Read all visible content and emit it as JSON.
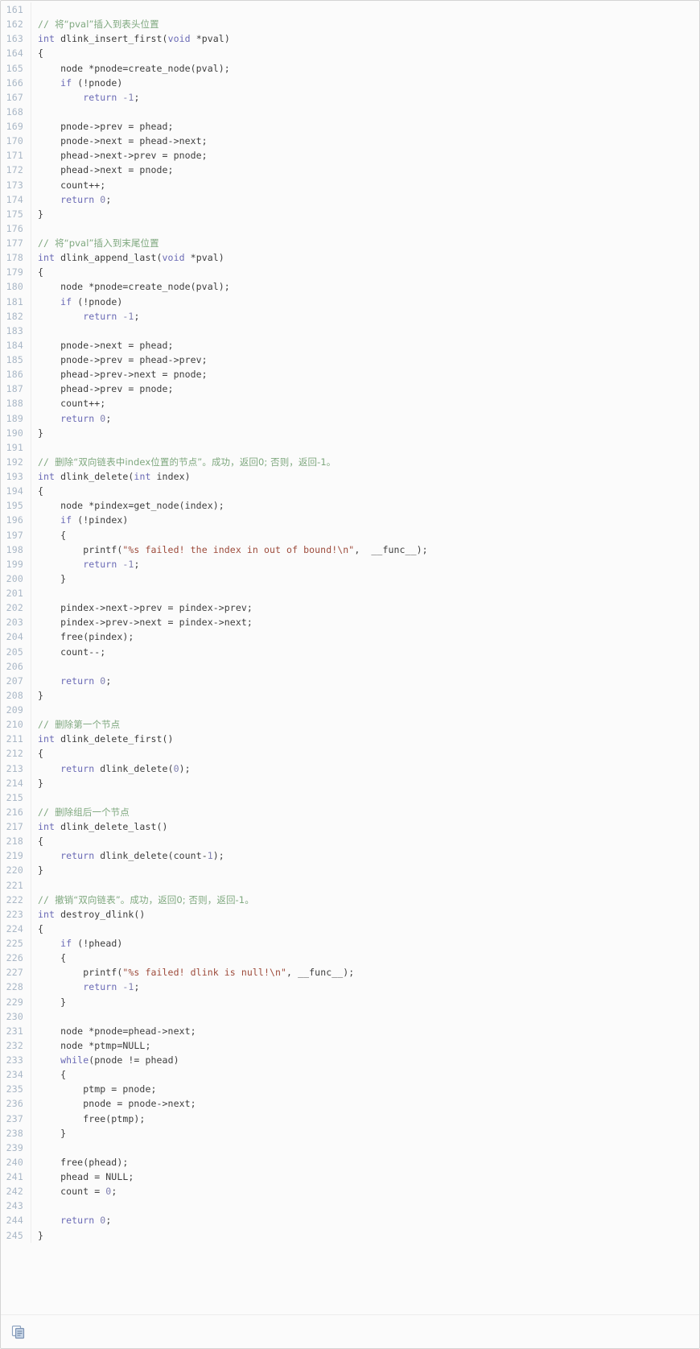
{
  "viewer": {
    "title": "C source code viewer",
    "language": "c",
    "first_line_number": 161,
    "last_line_number": 245,
    "gutter_color": "#a9b7c6",
    "background_color": "#fbfbfb",
    "border_color": "#d4d4d4"
  },
  "theme": {
    "plain": "#3c3c3c",
    "keyword": "#6a6ab5",
    "comment": "#7fa87f",
    "string": "#9d4b3b",
    "number": "#7f7fb0"
  },
  "footer": {
    "copy_icon_name": "copy-icon",
    "copy_icon_label": "copy",
    "copy_icon_color": "#8ea3c0"
  },
  "lines": [
    {
      "n": 161,
      "tokens": []
    },
    {
      "n": 162,
      "tokens": [
        {
          "t": "cmt",
          "v": "// "
        },
        {
          "t": "cmt-cn",
          "v": "将“pval”插入到表头位置"
        }
      ]
    },
    {
      "n": 163,
      "tokens": [
        {
          "t": "kw",
          "v": "int"
        },
        {
          "t": "plain",
          "v": " dlink_insert_first("
        },
        {
          "t": "kw",
          "v": "void"
        },
        {
          "t": "plain",
          "v": " *pval)"
        }
      ]
    },
    {
      "n": 164,
      "tokens": [
        {
          "t": "plain",
          "v": "{"
        }
      ]
    },
    {
      "n": 165,
      "tokens": [
        {
          "t": "plain",
          "v": "    node *pnode=create_node(pval);"
        }
      ]
    },
    {
      "n": 166,
      "tokens": [
        {
          "t": "plain",
          "v": "    "
        },
        {
          "t": "kw",
          "v": "if"
        },
        {
          "t": "plain",
          "v": " (!pnode)"
        }
      ]
    },
    {
      "n": 167,
      "tokens": [
        {
          "t": "plain",
          "v": "        "
        },
        {
          "t": "kw",
          "v": "return"
        },
        {
          "t": "plain",
          "v": " "
        },
        {
          "t": "num",
          "v": "-1"
        },
        {
          "t": "plain",
          "v": ";"
        }
      ]
    },
    {
      "n": 168,
      "tokens": []
    },
    {
      "n": 169,
      "tokens": [
        {
          "t": "plain",
          "v": "    pnode->prev = phead;"
        }
      ]
    },
    {
      "n": 170,
      "tokens": [
        {
          "t": "plain",
          "v": "    pnode->next = phead->next;"
        }
      ]
    },
    {
      "n": 171,
      "tokens": [
        {
          "t": "plain",
          "v": "    phead->next->prev = pnode;"
        }
      ]
    },
    {
      "n": 172,
      "tokens": [
        {
          "t": "plain",
          "v": "    phead->next = pnode;"
        }
      ]
    },
    {
      "n": 173,
      "tokens": [
        {
          "t": "plain",
          "v": "    count++;"
        }
      ]
    },
    {
      "n": 174,
      "tokens": [
        {
          "t": "plain",
          "v": "    "
        },
        {
          "t": "kw",
          "v": "return"
        },
        {
          "t": "plain",
          "v": " "
        },
        {
          "t": "num",
          "v": "0"
        },
        {
          "t": "plain",
          "v": ";"
        }
      ]
    },
    {
      "n": 175,
      "tokens": [
        {
          "t": "plain",
          "v": "}"
        }
      ]
    },
    {
      "n": 176,
      "tokens": []
    },
    {
      "n": 177,
      "tokens": [
        {
          "t": "cmt",
          "v": "// "
        },
        {
          "t": "cmt-cn",
          "v": "将“pval”插入到末尾位置"
        }
      ]
    },
    {
      "n": 178,
      "tokens": [
        {
          "t": "kw",
          "v": "int"
        },
        {
          "t": "plain",
          "v": " dlink_append_last("
        },
        {
          "t": "kw",
          "v": "void"
        },
        {
          "t": "plain",
          "v": " *pval)"
        }
      ]
    },
    {
      "n": 179,
      "tokens": [
        {
          "t": "plain",
          "v": "{"
        }
      ]
    },
    {
      "n": 180,
      "tokens": [
        {
          "t": "plain",
          "v": "    node *pnode=create_node(pval);"
        }
      ]
    },
    {
      "n": 181,
      "tokens": [
        {
          "t": "plain",
          "v": "    "
        },
        {
          "t": "kw",
          "v": "if"
        },
        {
          "t": "plain",
          "v": " (!pnode)"
        }
      ]
    },
    {
      "n": 182,
      "tokens": [
        {
          "t": "plain",
          "v": "        "
        },
        {
          "t": "kw",
          "v": "return"
        },
        {
          "t": "plain",
          "v": " "
        },
        {
          "t": "num",
          "v": "-1"
        },
        {
          "t": "plain",
          "v": ";"
        }
      ]
    },
    {
      "n": 183,
      "tokens": []
    },
    {
      "n": 184,
      "tokens": [
        {
          "t": "plain",
          "v": "    pnode->next = phead;"
        }
      ]
    },
    {
      "n": 185,
      "tokens": [
        {
          "t": "plain",
          "v": "    pnode->prev = phead->prev;"
        }
      ]
    },
    {
      "n": 186,
      "tokens": [
        {
          "t": "plain",
          "v": "    phead->prev->next = pnode;"
        }
      ]
    },
    {
      "n": 187,
      "tokens": [
        {
          "t": "plain",
          "v": "    phead->prev = pnode;"
        }
      ]
    },
    {
      "n": 188,
      "tokens": [
        {
          "t": "plain",
          "v": "    count++;"
        }
      ]
    },
    {
      "n": 189,
      "tokens": [
        {
          "t": "plain",
          "v": "    "
        },
        {
          "t": "kw",
          "v": "return"
        },
        {
          "t": "plain",
          "v": " "
        },
        {
          "t": "num",
          "v": "0"
        },
        {
          "t": "plain",
          "v": ";"
        }
      ]
    },
    {
      "n": 190,
      "tokens": [
        {
          "t": "plain",
          "v": "}"
        }
      ]
    },
    {
      "n": 191,
      "tokens": []
    },
    {
      "n": 192,
      "tokens": [
        {
          "t": "cmt",
          "v": "// "
        },
        {
          "t": "cmt-cn",
          "v": "删除“双向链表中index位置的节点”。成功，返回0; 否则，返回-1。"
        }
      ]
    },
    {
      "n": 193,
      "tokens": [
        {
          "t": "kw",
          "v": "int"
        },
        {
          "t": "plain",
          "v": " dlink_delete("
        },
        {
          "t": "kw",
          "v": "int"
        },
        {
          "t": "plain",
          "v": " index)"
        }
      ]
    },
    {
      "n": 194,
      "tokens": [
        {
          "t": "plain",
          "v": "{"
        }
      ]
    },
    {
      "n": 195,
      "tokens": [
        {
          "t": "plain",
          "v": "    node *pindex=get_node(index);"
        }
      ]
    },
    {
      "n": 196,
      "tokens": [
        {
          "t": "plain",
          "v": "    "
        },
        {
          "t": "kw",
          "v": "if"
        },
        {
          "t": "plain",
          "v": " (!pindex)"
        }
      ]
    },
    {
      "n": 197,
      "tokens": [
        {
          "t": "plain",
          "v": "    {"
        }
      ]
    },
    {
      "n": 198,
      "tokens": [
        {
          "t": "plain",
          "v": "        printf("
        },
        {
          "t": "str",
          "v": "\"%s failed! the index in out of bound!\\n\""
        },
        {
          "t": "plain",
          "v": ",  __func__);"
        }
      ]
    },
    {
      "n": 199,
      "tokens": [
        {
          "t": "plain",
          "v": "        "
        },
        {
          "t": "kw",
          "v": "return"
        },
        {
          "t": "plain",
          "v": " "
        },
        {
          "t": "num",
          "v": "-1"
        },
        {
          "t": "plain",
          "v": ";"
        }
      ]
    },
    {
      "n": 200,
      "tokens": [
        {
          "t": "plain",
          "v": "    }"
        }
      ]
    },
    {
      "n": 201,
      "tokens": []
    },
    {
      "n": 202,
      "tokens": [
        {
          "t": "plain",
          "v": "    pindex->next->prev = pindex->prev;"
        }
      ]
    },
    {
      "n": 203,
      "tokens": [
        {
          "t": "plain",
          "v": "    pindex->prev->next = pindex->next;"
        }
      ]
    },
    {
      "n": 204,
      "tokens": [
        {
          "t": "plain",
          "v": "    free(pindex);"
        }
      ]
    },
    {
      "n": 205,
      "tokens": [
        {
          "t": "plain",
          "v": "    count--;"
        }
      ]
    },
    {
      "n": 206,
      "tokens": []
    },
    {
      "n": 207,
      "tokens": [
        {
          "t": "plain",
          "v": "    "
        },
        {
          "t": "kw",
          "v": "return"
        },
        {
          "t": "plain",
          "v": " "
        },
        {
          "t": "num",
          "v": "0"
        },
        {
          "t": "plain",
          "v": ";"
        }
      ]
    },
    {
      "n": 208,
      "tokens": [
        {
          "t": "plain",
          "v": "}"
        }
      ]
    },
    {
      "n": 209,
      "tokens": []
    },
    {
      "n": 210,
      "tokens": [
        {
          "t": "cmt",
          "v": "// "
        },
        {
          "t": "cmt-cn",
          "v": "删除第一个节点"
        }
      ]
    },
    {
      "n": 211,
      "tokens": [
        {
          "t": "kw",
          "v": "int"
        },
        {
          "t": "plain",
          "v": " dlink_delete_first()"
        }
      ]
    },
    {
      "n": 212,
      "tokens": [
        {
          "t": "plain",
          "v": "{"
        }
      ]
    },
    {
      "n": 213,
      "tokens": [
        {
          "t": "plain",
          "v": "    "
        },
        {
          "t": "kw",
          "v": "return"
        },
        {
          "t": "plain",
          "v": " dlink_delete("
        },
        {
          "t": "num",
          "v": "0"
        },
        {
          "t": "plain",
          "v": ");"
        }
      ]
    },
    {
      "n": 214,
      "tokens": [
        {
          "t": "plain",
          "v": "}"
        }
      ]
    },
    {
      "n": 215,
      "tokens": []
    },
    {
      "n": 216,
      "tokens": [
        {
          "t": "cmt",
          "v": "// "
        },
        {
          "t": "cmt-cn",
          "v": "删除组后一个节点"
        }
      ]
    },
    {
      "n": 217,
      "tokens": [
        {
          "t": "kw",
          "v": "int"
        },
        {
          "t": "plain",
          "v": " dlink_delete_last()"
        }
      ]
    },
    {
      "n": 218,
      "tokens": [
        {
          "t": "plain",
          "v": "{"
        }
      ]
    },
    {
      "n": 219,
      "tokens": [
        {
          "t": "plain",
          "v": "    "
        },
        {
          "t": "kw",
          "v": "return"
        },
        {
          "t": "plain",
          "v": " dlink_delete(count-"
        },
        {
          "t": "num",
          "v": "1"
        },
        {
          "t": "plain",
          "v": ");"
        }
      ]
    },
    {
      "n": 220,
      "tokens": [
        {
          "t": "plain",
          "v": "}"
        }
      ]
    },
    {
      "n": 221,
      "tokens": []
    },
    {
      "n": 222,
      "tokens": [
        {
          "t": "cmt",
          "v": "// "
        },
        {
          "t": "cmt-cn",
          "v": "撤销“双向链表”。成功，返回0; 否则，返回-1。"
        }
      ]
    },
    {
      "n": 223,
      "tokens": [
        {
          "t": "kw",
          "v": "int"
        },
        {
          "t": "plain",
          "v": " destroy_dlink()"
        }
      ]
    },
    {
      "n": 224,
      "tokens": [
        {
          "t": "plain",
          "v": "{"
        }
      ]
    },
    {
      "n": 225,
      "tokens": [
        {
          "t": "plain",
          "v": "    "
        },
        {
          "t": "kw",
          "v": "if"
        },
        {
          "t": "plain",
          "v": " (!phead)"
        }
      ]
    },
    {
      "n": 226,
      "tokens": [
        {
          "t": "plain",
          "v": "    {"
        }
      ]
    },
    {
      "n": 227,
      "tokens": [
        {
          "t": "plain",
          "v": "        printf("
        },
        {
          "t": "str",
          "v": "\"%s failed! dlink is null!\\n\""
        },
        {
          "t": "plain",
          "v": ", __func__);"
        }
      ]
    },
    {
      "n": 228,
      "tokens": [
        {
          "t": "plain",
          "v": "        "
        },
        {
          "t": "kw",
          "v": "return"
        },
        {
          "t": "plain",
          "v": " "
        },
        {
          "t": "num",
          "v": "-1"
        },
        {
          "t": "plain",
          "v": ";"
        }
      ]
    },
    {
      "n": 229,
      "tokens": [
        {
          "t": "plain",
          "v": "    }"
        }
      ]
    },
    {
      "n": 230,
      "tokens": []
    },
    {
      "n": 231,
      "tokens": [
        {
          "t": "plain",
          "v": "    node *pnode=phead->next;"
        }
      ]
    },
    {
      "n": 232,
      "tokens": [
        {
          "t": "plain",
          "v": "    node *ptmp=NULL;"
        }
      ]
    },
    {
      "n": 233,
      "tokens": [
        {
          "t": "plain",
          "v": "    "
        },
        {
          "t": "kw",
          "v": "while"
        },
        {
          "t": "plain",
          "v": "(pnode != phead)"
        }
      ]
    },
    {
      "n": 234,
      "tokens": [
        {
          "t": "plain",
          "v": "    {"
        }
      ]
    },
    {
      "n": 235,
      "tokens": [
        {
          "t": "plain",
          "v": "        ptmp = pnode;"
        }
      ]
    },
    {
      "n": 236,
      "tokens": [
        {
          "t": "plain",
          "v": "        pnode = pnode->next;"
        }
      ]
    },
    {
      "n": 237,
      "tokens": [
        {
          "t": "plain",
          "v": "        free(ptmp);"
        }
      ]
    },
    {
      "n": 238,
      "tokens": [
        {
          "t": "plain",
          "v": "    }"
        }
      ]
    },
    {
      "n": 239,
      "tokens": []
    },
    {
      "n": 240,
      "tokens": [
        {
          "t": "plain",
          "v": "    free(phead);"
        }
      ]
    },
    {
      "n": 241,
      "tokens": [
        {
          "t": "plain",
          "v": "    phead = NULL;"
        }
      ]
    },
    {
      "n": 242,
      "tokens": [
        {
          "t": "plain",
          "v": "    count = "
        },
        {
          "t": "num",
          "v": "0"
        },
        {
          "t": "plain",
          "v": ";"
        }
      ]
    },
    {
      "n": 243,
      "tokens": []
    },
    {
      "n": 244,
      "tokens": [
        {
          "t": "plain",
          "v": "    "
        },
        {
          "t": "kw",
          "v": "return"
        },
        {
          "t": "plain",
          "v": " "
        },
        {
          "t": "num",
          "v": "0"
        },
        {
          "t": "plain",
          "v": ";"
        }
      ]
    },
    {
      "n": 245,
      "tokens": [
        {
          "t": "plain",
          "v": "}"
        }
      ]
    }
  ]
}
